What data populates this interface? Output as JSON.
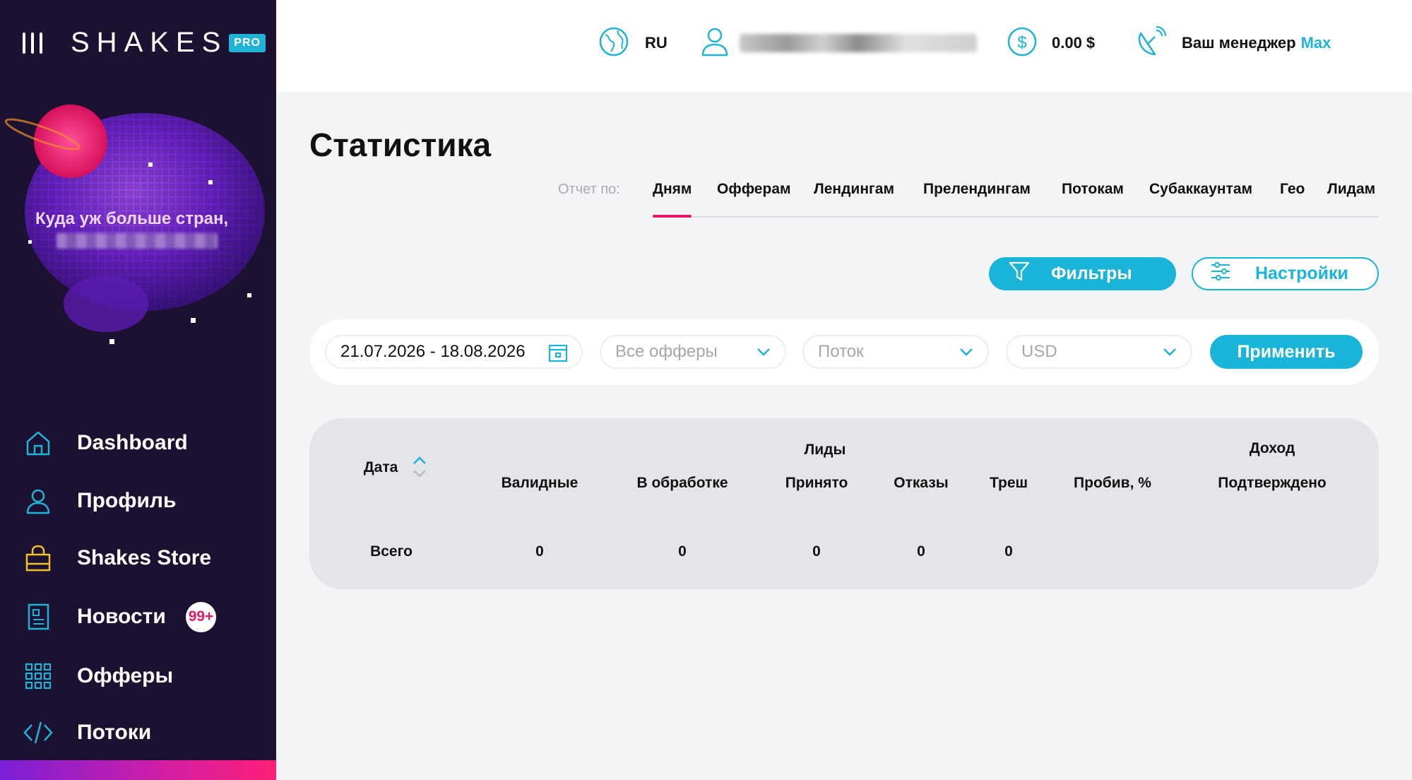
{
  "brand": {
    "logo_text": "SHAKES",
    "logo_badge": "PRO"
  },
  "sidebar": {
    "promo_text": "Куда уж больше стран,",
    "items": [
      {
        "label": "Dashboard",
        "icon": "home-icon"
      },
      {
        "label": "Профиль",
        "icon": "user-icon"
      },
      {
        "label": "Shakes Store",
        "icon": "bag-icon"
      },
      {
        "label": "Новости",
        "icon": "news-icon",
        "badge": "99+"
      },
      {
        "label": "Офферы",
        "icon": "grid-icon"
      },
      {
        "label": "Потоки",
        "icon": "code-icon"
      }
    ]
  },
  "header": {
    "language": "RU",
    "balance": "0.00 $",
    "manager_label": "Ваш менеджер",
    "manager_name": "Max"
  },
  "page": {
    "title": "Статистика",
    "report_label": "Отчет по:",
    "tabs": [
      "Дням",
      "Офферам",
      "Лендингам",
      "Прелендингам",
      "Потокам",
      "Субаккаунтам",
      "Гео",
      "Лидам"
    ],
    "active_tab": "Дням",
    "filters_button": "Фильтры",
    "settings_button": "Настройки"
  },
  "filter_bar": {
    "date_range": "21.07.2026 - 18.08.2026",
    "offers_placeholder": "Все офферы",
    "stream_placeholder": "Поток",
    "currency": "USD",
    "apply_button": "Применить"
  },
  "table": {
    "date_header": "Дата",
    "leads_group": "Лиды",
    "income_group": "Доход",
    "columns": [
      "Валидные",
      "В обработке",
      "Принято",
      "Отказы",
      "Треш",
      "Пробив, %",
      "Подтверждено"
    ],
    "total_row": {
      "label": "Всего",
      "values": [
        "0",
        "0",
        "0",
        "0",
        "0"
      ]
    }
  },
  "colors": {
    "accent": "#1ab4d8",
    "active_tab": "#e6196d",
    "sidebar_bg": "#1c1130",
    "badge_text": "#e0186c"
  }
}
